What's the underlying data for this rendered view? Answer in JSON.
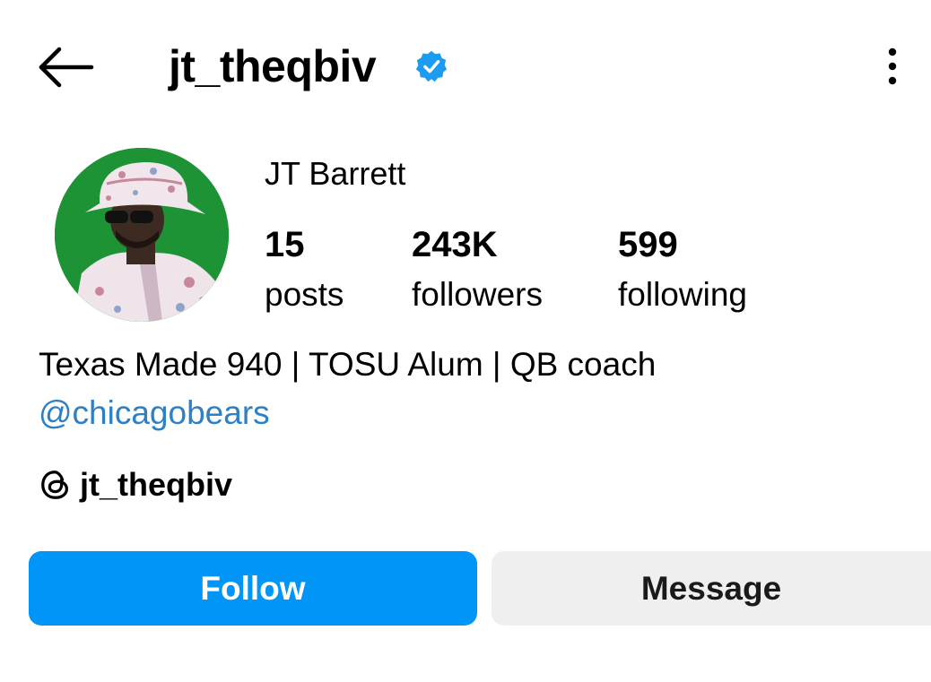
{
  "header": {
    "username": "jt_theqbiv",
    "verified": true,
    "back_icon": "arrow-left-icon",
    "more_icon": "more-vertical-icon"
  },
  "profile": {
    "display_name": "JT Barrett",
    "avatar_icon": "profile-photo",
    "stats": [
      {
        "value": "15",
        "label": "posts"
      },
      {
        "value": "243K",
        "label": "followers"
      },
      {
        "value": "599",
        "label": "following"
      }
    ],
    "bio": "Texas Made 940 | TOSU Alum | QB coach",
    "bio_link": "@chicagobears",
    "threads_handle": "jt_theqbiv"
  },
  "actions": {
    "follow_label": "Follow",
    "message_label": "Message"
  },
  "colors": {
    "accent": "#0095f6",
    "link": "#2f7fc3",
    "verified": "#1d9bf0",
    "secondary_button": "#efefef"
  }
}
